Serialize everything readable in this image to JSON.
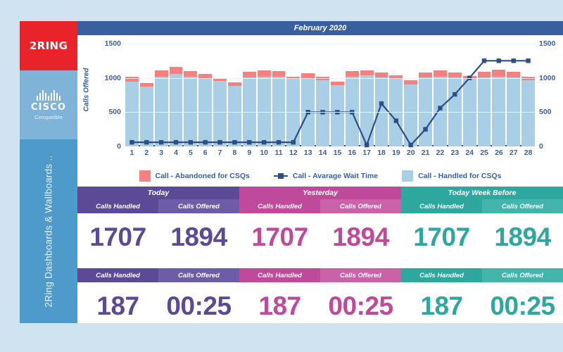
{
  "sidebar": {
    "logo_text": "2RING",
    "logo_bg": "#e8232a",
    "cisco_icon": "cisco-bridge-icon",
    "cisco_name": "CISCO",
    "cisco_sub": "Compatible",
    "cisco_bg": "#7fb4d8",
    "vertical_tag": "2Ring Dashboards & Wallboards ..",
    "tag_bg": "#4e9acb"
  },
  "chart_data": {
    "type": "bar",
    "title": "February 2020",
    "xlabel": "",
    "ylabel": "Calls Offered",
    "ylim": [
      0,
      1500
    ],
    "y_ticks": [
      0,
      500,
      1000,
      1500
    ],
    "y_ticks_right": [
      0,
      500,
      1000,
      1500
    ],
    "right_axis_label": "",
    "grid": true,
    "legend_position": "bottom",
    "categories": [
      "1",
      "2",
      "3",
      "4",
      "5",
      "6",
      "7",
      "8",
      "9",
      "10",
      "11",
      "12",
      "13",
      "14",
      "15",
      "16",
      "17",
      "18",
      "19",
      "20",
      "21",
      "22",
      "23",
      "24",
      "25",
      "26",
      "27",
      "28"
    ],
    "stacked": true,
    "series": [
      {
        "name": "Call - Handled for CSQs",
        "color": "#a9cfe6",
        "type": "bar",
        "values": [
          950,
          875,
          1020,
          1060,
          1015,
          1000,
          955,
          880,
          1010,
          1020,
          1015,
          985,
          1000,
          965,
          890,
          1020,
          1040,
          1010,
          985,
          900,
          1010,
          1015,
          1005,
          985,
          1010,
          1020,
          1010,
          965
        ]
      },
      {
        "name": "Call - Abandoned for CSQs",
        "color": "#f4807f",
        "type": "bar",
        "values": [
          70,
          55,
          85,
          105,
          85,
          55,
          35,
          60,
          75,
          95,
          80,
          30,
          65,
          55,
          60,
          75,
          70,
          65,
          55,
          65,
          70,
          95,
          75,
          45,
          80,
          100,
          75,
          50
        ]
      },
      {
        "name": "Call - Avarage Wait Time",
        "color": "#2d4f88",
        "type": "line",
        "axis": "right",
        "values": [
          60,
          60,
          60,
          60,
          60,
          60,
          60,
          60,
          60,
          60,
          60,
          60,
          500,
          500,
          500,
          500,
          20,
          625,
          375,
          20,
          250,
          560,
          760,
          1000,
          1250,
          1250,
          1250,
          1250
        ]
      }
    ]
  },
  "kpi": {
    "groups": [
      {
        "label": "Today",
        "header_color": "#5c4a96",
        "sub_color": "#6d5ca8",
        "value_color": "#5c4a96"
      },
      {
        "label": "Yesterday",
        "header_color": "#bf4a9b",
        "sub_color": "#c962a9",
        "value_color": "#bf4a9b"
      },
      {
        "label": "Today Week Before",
        "header_color": "#2ea79e",
        "sub_color": "#43b5ad",
        "value_color": "#2ea79e"
      }
    ],
    "table_one": {
      "columns": [
        "Calls Handled",
        "Calls Offered"
      ],
      "rows_by_group": [
        [
          "1707",
          "1894"
        ],
        [
          "1707",
          "1894"
        ],
        [
          "1707",
          "1894"
        ]
      ]
    },
    "table_two": {
      "columns": [
        "Calls Handled",
        "Calls Offered"
      ],
      "rows_by_group": [
        [
          "187",
          "00:25"
        ],
        [
          "187",
          "00:25"
        ],
        [
          "187",
          "00:25"
        ]
      ]
    }
  }
}
